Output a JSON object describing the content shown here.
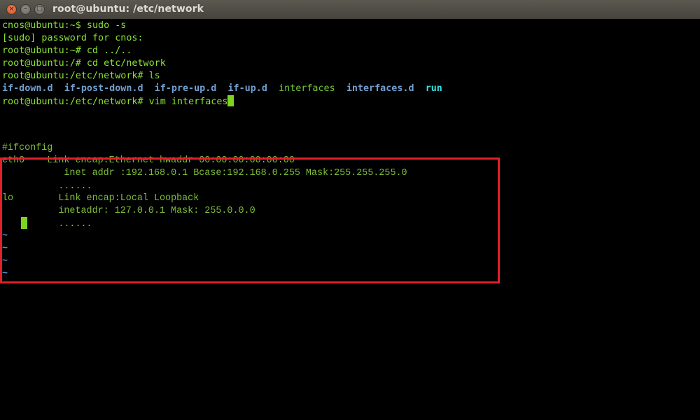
{
  "window": {
    "title": "root@ubuntu: /etc/network",
    "buttons": {
      "close": "×",
      "minimize": "–",
      "maximize": "□"
    }
  },
  "shell": {
    "lines": [
      {
        "prompt": "cnos@ubuntu:~$",
        "command": " sudo -s"
      },
      {
        "text": "[sudo] password for cnos:"
      },
      {
        "prompt": "root@ubuntu:~#",
        "command": " cd ../.."
      },
      {
        "prompt": "root@ubuntu:/#",
        "command": " cd etc/network"
      },
      {
        "prompt": "root@ubuntu:/etc/network#",
        "command": " ls"
      }
    ],
    "ls_output": [
      {
        "name": "if-down.d",
        "type": "dir"
      },
      {
        "name": "if-post-down.d",
        "type": "dir"
      },
      {
        "name": "if-pre-up.d",
        "type": "dir"
      },
      {
        "name": "if-up.d",
        "type": "dir"
      },
      {
        "name": "interfaces",
        "type": "file"
      },
      {
        "name": "interfaces.d",
        "type": "dir"
      },
      {
        "name": "run",
        "type": "dir-special"
      }
    ],
    "last_prompt": "root@ubuntu:/etc/network#",
    "last_command": " vim interfaces"
  },
  "vim": {
    "lines": [
      "#ifconfig",
      "eth0    Link encap:Ethernet hwaddr 00:00:00:00:00:00",
      "           inet addr :192.168.0.1 Bcase:192.168.0.255 Mask:255.255.255.0",
      "          ......",
      "lo        Link encap:Local Loopback",
      "          inetaddr: 127.0.0.1 Mask: 255.0.0.0",
      "          ......"
    ],
    "empty_marker": "~"
  },
  "colors": {
    "highlight_box": "#e0202a",
    "prompt_green": "#8ae234",
    "dir_blue": "#729fcf",
    "cursor": "#7ed321"
  }
}
